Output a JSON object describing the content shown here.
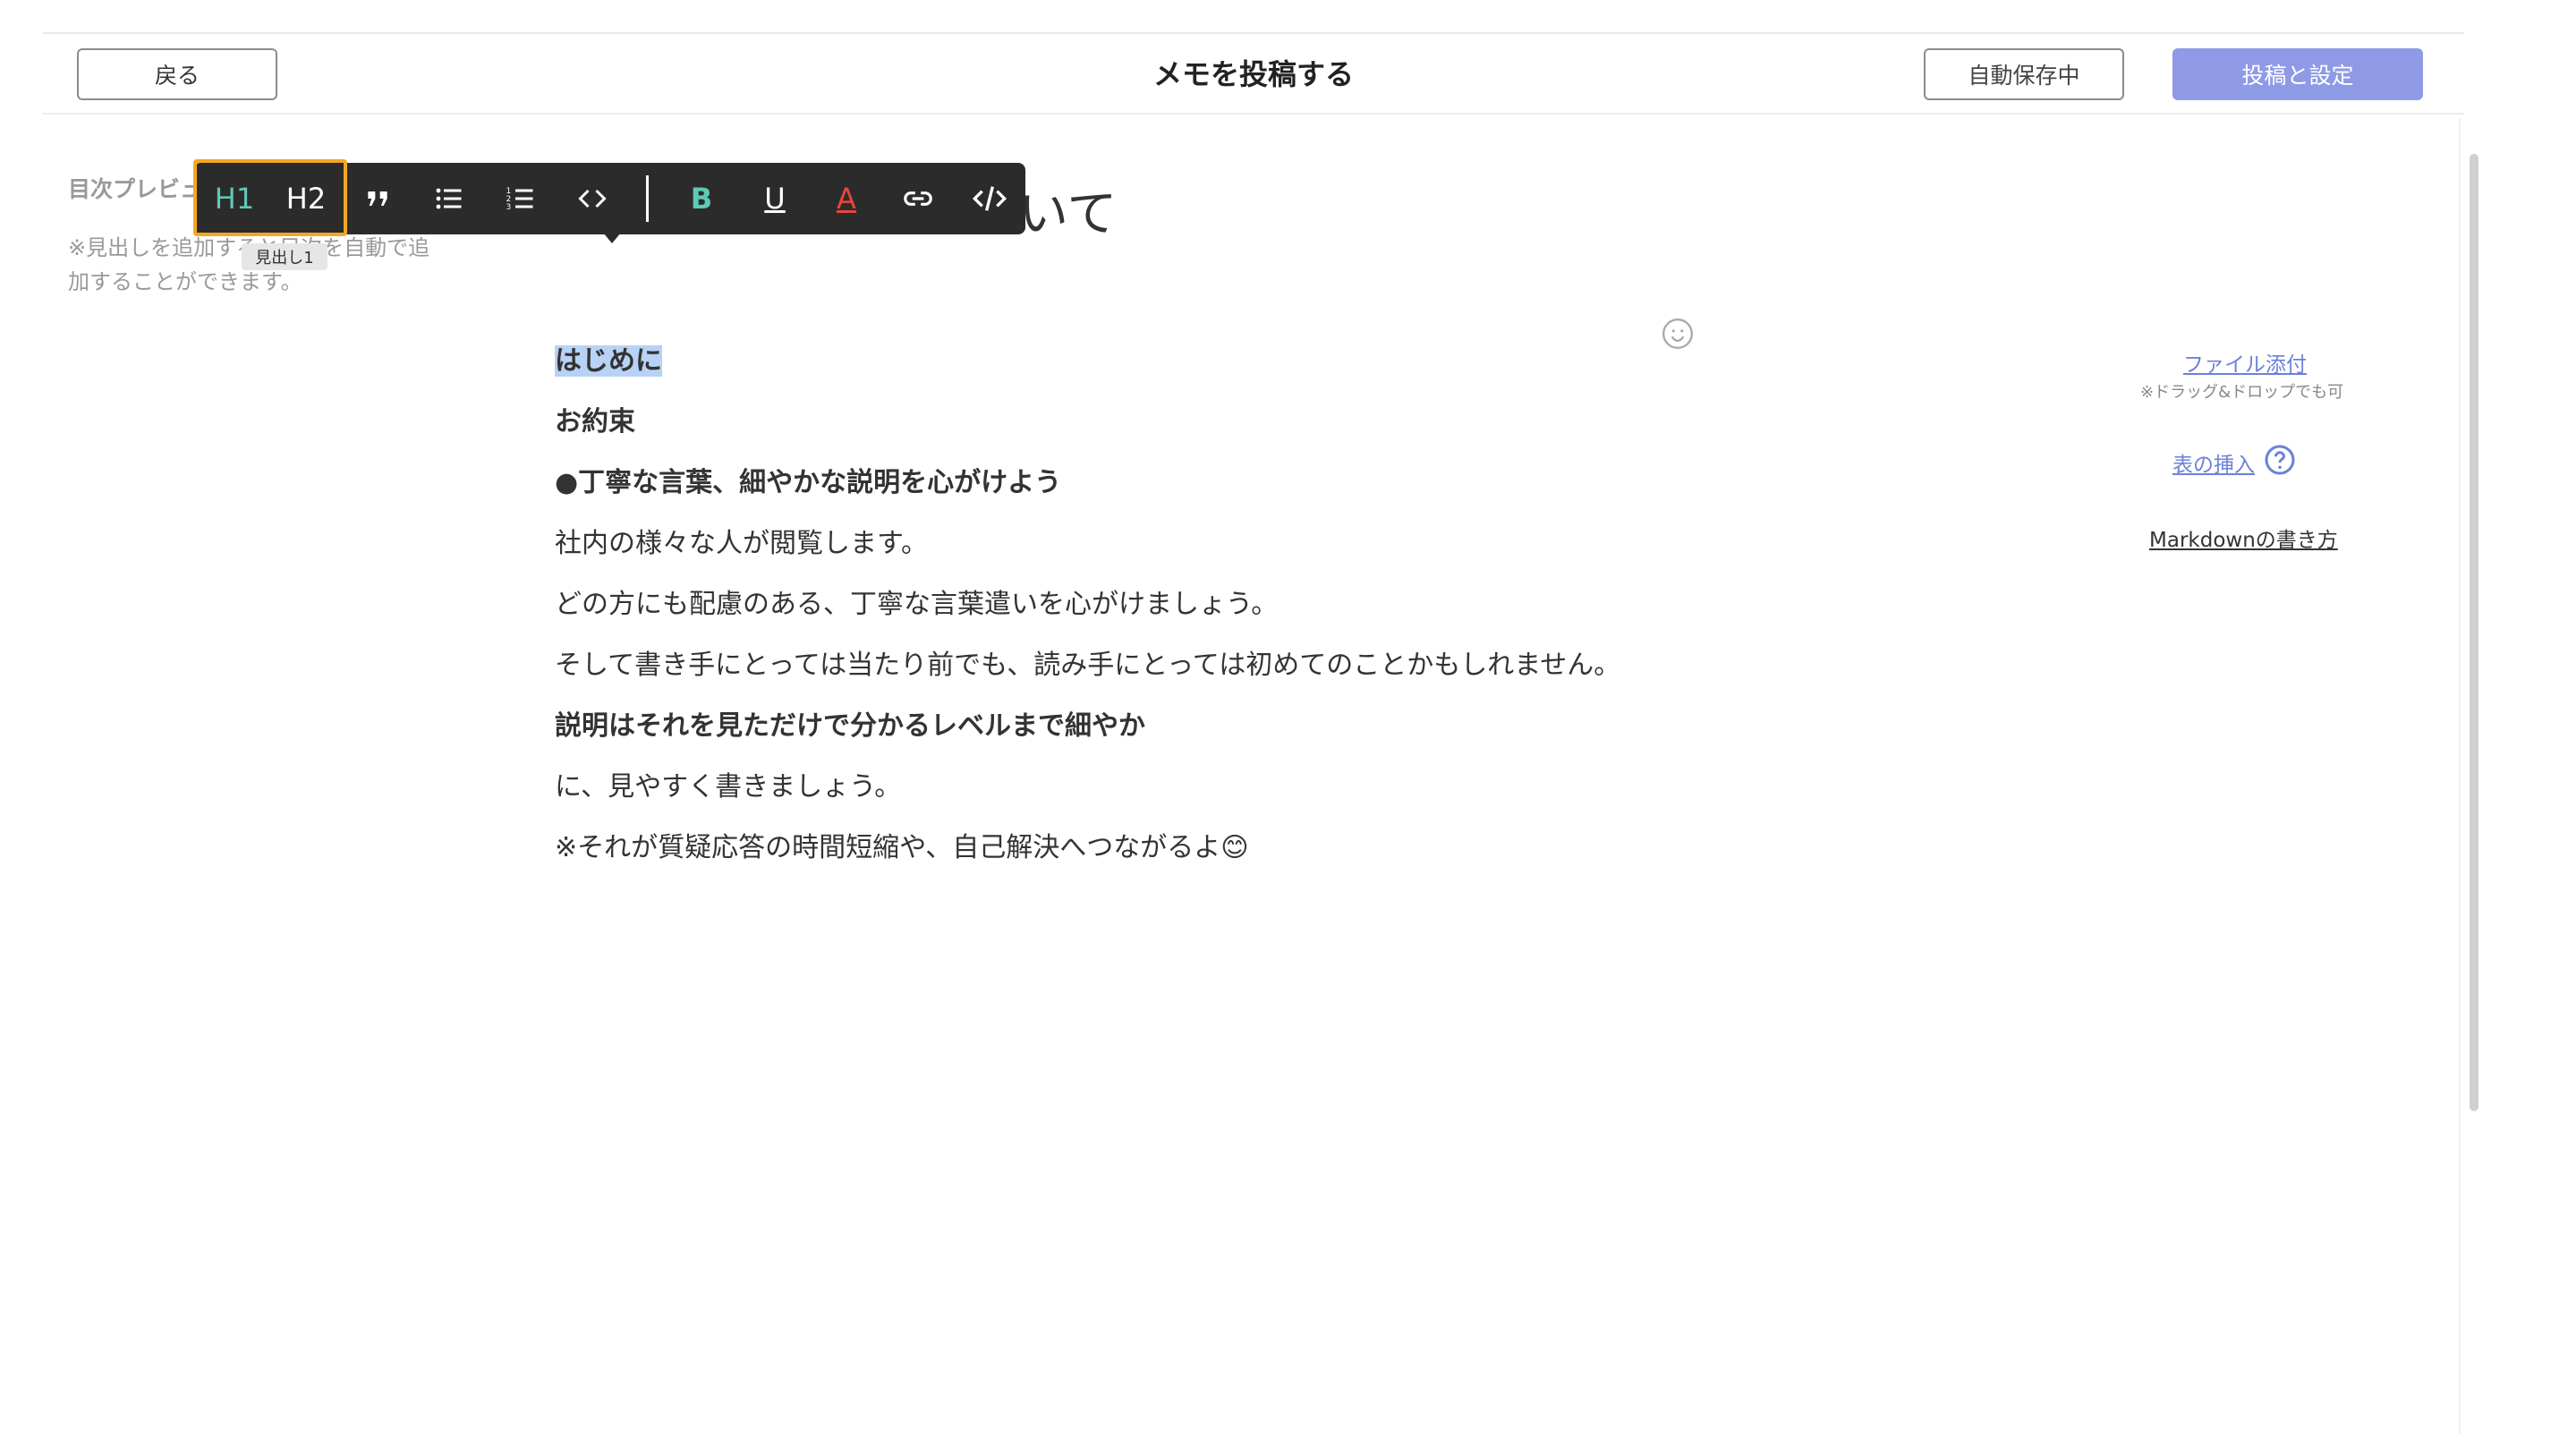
{
  "header": {
    "back_label": "戻る",
    "title": "メモを投稿する",
    "autosave_label": "自動保存中",
    "post_label": "投稿と設定"
  },
  "toc": {
    "title": "目次プレビュー",
    "note": "※見出しを追加すると目次を自動で追加することができます。"
  },
  "toolbar": {
    "h1": "H1",
    "h2": "H2",
    "tooltip": "見出し1",
    "bold": "B",
    "underline": "U",
    "color": "A",
    "color_accent": "#e8453c",
    "h_accent": "#5ec9b5",
    "highlight_color": "#f5a623"
  },
  "document": {
    "title_visible": "いて",
    "lines": [
      "はじめに",
      "お約束",
      "●丁寧な言葉、細やかな説明を心がけよう",
      "社内の様々な人が閲覧します。",
      "どの方にも配慮のある、丁寧な言葉遣いを心がけましょう。",
      "そして書き手にとっては当たり前でも、読み手にとっては初めてのことかもしれません。",
      "説明はそれを見ただけで分かるレベルまで細やか",
      "に、見やすく書きましょう。",
      "※それが質疑応答の時間短縮や、自己解決へつながるよ😊"
    ]
  },
  "sidebar": {
    "file_attach": "ファイル添付",
    "file_attach_note": "※ドラッグ&ドロップでも可",
    "insert_table": "表の挿入",
    "markdown_help": "Markdownの書き方"
  }
}
